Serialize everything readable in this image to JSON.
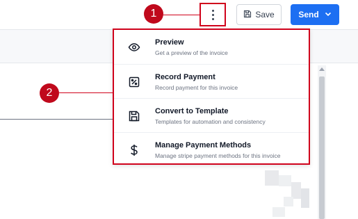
{
  "toolbar": {
    "more_icon": "vertical-dots-icon",
    "save_label": "Save",
    "save_icon": "floppy-disk-icon",
    "send_label": "Send",
    "send_icon": "chevron-down-icon"
  },
  "menu": {
    "items": [
      {
        "title": "Preview",
        "subtitle": "Get a preview of the invoice",
        "icon": "eye-icon"
      },
      {
        "title": "Record Payment",
        "subtitle": "Record payment for this invoice",
        "icon": "percent-receipt-icon"
      },
      {
        "title": "Convert to Template",
        "subtitle": "Templates for automation and consistency",
        "icon": "floppy-disk-icon"
      },
      {
        "title": "Manage Payment Methods",
        "subtitle": "Manage stripe payment methods for this invoice",
        "icon": "dollar-icon"
      }
    ]
  },
  "callouts": [
    {
      "number": "1"
    },
    {
      "number": "2"
    }
  ],
  "colors": {
    "accent": "#1d6ff2",
    "annotation": "#d0021b"
  }
}
